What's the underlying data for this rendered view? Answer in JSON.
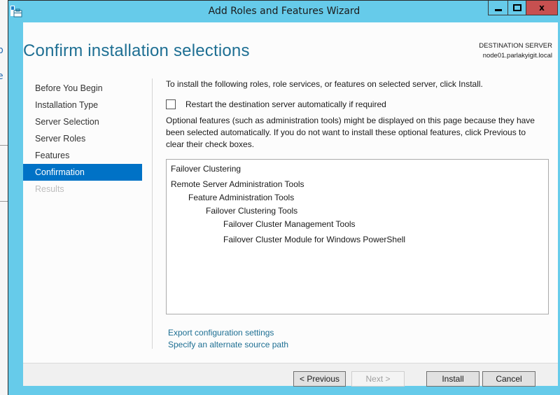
{
  "window": {
    "title": "Add Roles and Features Wizard",
    "close_glyph": "x"
  },
  "header": {
    "page_title": "Confirm installation selections",
    "destination_label": "DESTINATION SERVER",
    "destination_value": "node01.parlakyigit.local"
  },
  "nav": {
    "items": [
      {
        "label": "Before You Begin",
        "state": "normal"
      },
      {
        "label": "Installation Type",
        "state": "normal"
      },
      {
        "label": "Server Selection",
        "state": "normal"
      },
      {
        "label": "Server Roles",
        "state": "normal"
      },
      {
        "label": "Features",
        "state": "normal"
      },
      {
        "label": "Confirmation",
        "state": "active"
      },
      {
        "label": "Results",
        "state": "disabled"
      }
    ]
  },
  "content": {
    "intro": "To install the following roles, role services, or features on selected server, click Install.",
    "restart_checkbox_label": "Restart the destination server automatically if required",
    "restart_checked": false,
    "optional_note": "Optional features (such as administration tools) might be displayed on this page because they have been selected automatically. If you do not want to install these optional features, click Previous to clear their check boxes.",
    "selections": [
      {
        "label": "Failover Clustering",
        "level": 0
      },
      {
        "label": "Remote Server Administration Tools",
        "level": 0
      },
      {
        "label": "Feature Administration Tools",
        "level": 1
      },
      {
        "label": "Failover Clustering Tools",
        "level": 2
      },
      {
        "label": "Failover Cluster Management Tools",
        "level": 3
      },
      {
        "label": "Failover Cluster Module for Windows PowerShell",
        "level": 3
      }
    ],
    "links": {
      "export": "Export configuration settings",
      "alternate_source": "Specify an alternate source path"
    }
  },
  "footer": {
    "previous": "< Previous",
    "next": "Next >",
    "install": "Install",
    "cancel": "Cancel"
  }
}
